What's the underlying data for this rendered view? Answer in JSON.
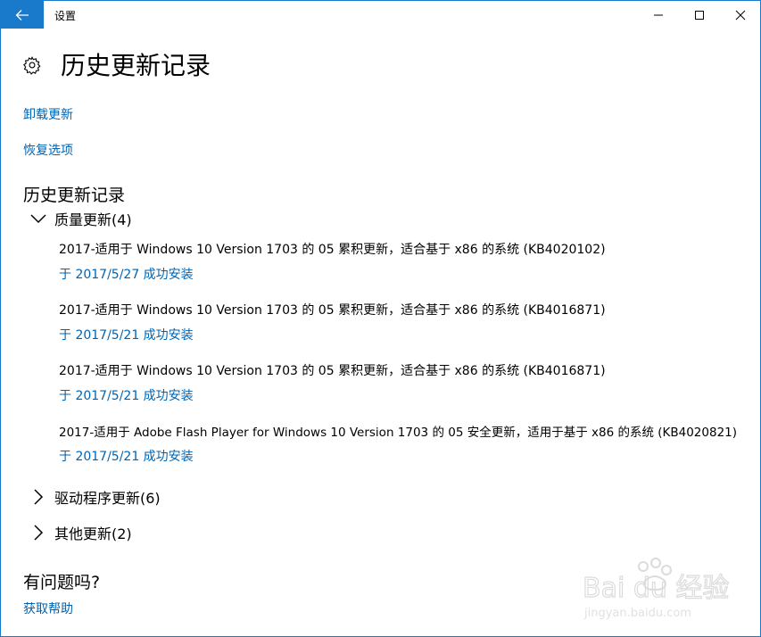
{
  "window": {
    "title": "设置"
  },
  "page": {
    "title": "历史更新记录"
  },
  "links": {
    "uninstall": "卸载更新",
    "recovery": "恢复选项"
  },
  "section": {
    "title": "历史更新记录"
  },
  "groups": {
    "quality": {
      "label": "质量更新(4)",
      "items": [
        {
          "name": "2017-适用于 Windows 10 Version 1703 的 05 累积更新，适合基于 x86 的系统 (KB4020102)",
          "status": "于 2017/5/27 成功安装"
        },
        {
          "name": "2017-适用于 Windows 10 Version 1703 的 05 累积更新，适合基于 x86 的系统 (KB4016871)",
          "status": "于 2017/5/21 成功安装"
        },
        {
          "name": "2017-适用于 Windows 10 Version 1703 的 05 累积更新，适合基于 x86 的系统 (KB4016871)",
          "status": "于 2017/5/21 成功安装"
        },
        {
          "name": "2017-适用于 Adobe Flash Player for Windows 10 Version 1703 的 05 安全更新，适用于基于 x86 的系统 (KB4020821)",
          "status": "于 2017/5/21 成功安装"
        }
      ]
    },
    "driver": {
      "label": "驱动程序更新(6)"
    },
    "other": {
      "label": "其他更新(2)"
    }
  },
  "help": {
    "title": "有问题吗?",
    "link": "获取帮助"
  },
  "watermark": {
    "brand": "Bai du 经验",
    "url": "jingyan.baidu.com"
  },
  "colors": {
    "accent": "#1979ca",
    "link": "#0063b1"
  }
}
